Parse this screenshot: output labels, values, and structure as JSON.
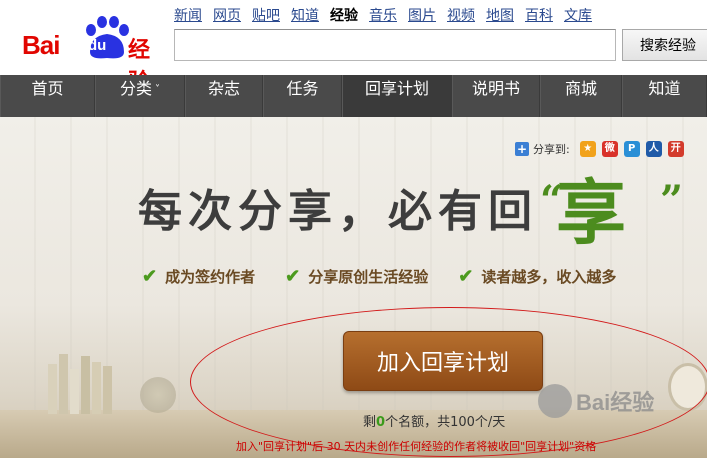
{
  "header": {
    "logo_bai": "Bai",
    "logo_du": "du",
    "logo_jingyan": "经验",
    "topnav": [
      {
        "label": "新闻",
        "active": false
      },
      {
        "label": "网页",
        "active": false
      },
      {
        "label": "贴吧",
        "active": false
      },
      {
        "label": "知道",
        "active": false
      },
      {
        "label": "经验",
        "active": true
      },
      {
        "label": "音乐",
        "active": false
      },
      {
        "label": "图片",
        "active": false
      },
      {
        "label": "视频",
        "active": false
      },
      {
        "label": "地图",
        "active": false
      },
      {
        "label": "百科",
        "active": false
      },
      {
        "label": "文库",
        "active": false
      }
    ],
    "search": {
      "value": "",
      "button_label": "搜索经验"
    }
  },
  "navbar": {
    "items": [
      "首页",
      "分类",
      "杂志",
      "任务",
      "回享计划",
      "说明书",
      "商城",
      "知道"
    ],
    "dropdown_caret": "˅",
    "active_index": 4
  },
  "banner": {
    "share_label": "分享到:",
    "share_icons": [
      {
        "name": "qzone-icon",
        "glyph": "★",
        "color": "#f1a21b"
      },
      {
        "name": "weibo-icon",
        "glyph": "微",
        "color": "#d9322a"
      },
      {
        "name": "tqq-icon",
        "glyph": "P",
        "color": "#2a8fd6"
      },
      {
        "name": "renren-icon",
        "glyph": "人",
        "color": "#1f5aa8"
      },
      {
        "name": "kaixin-icon",
        "glyph": "开",
        "color": "#d33b2c"
      }
    ],
    "slogan": "每次分享，必有回",
    "slogan_green": "享",
    "quote_left": "“",
    "quote_right": "”",
    "benefits": [
      "成为签约作者",
      "分享原创生活经验",
      "读者越多，收入越多"
    ],
    "join_button": "加入回享计划",
    "quota_prefix": "剩",
    "quota_num": "0",
    "quota_suffix": "个名额，共100个/天",
    "notice": "加入\"回享计划\"后 30 天内未创作任何经验的作者将被收回\"回享计划\"资格",
    "watermark": "Bai经验"
  },
  "colors": {
    "brand_red": "#e10601",
    "nav_bg": "#4a4a4a",
    "accent_green": "#4c8c1e",
    "button_brown": "#a05a20"
  }
}
